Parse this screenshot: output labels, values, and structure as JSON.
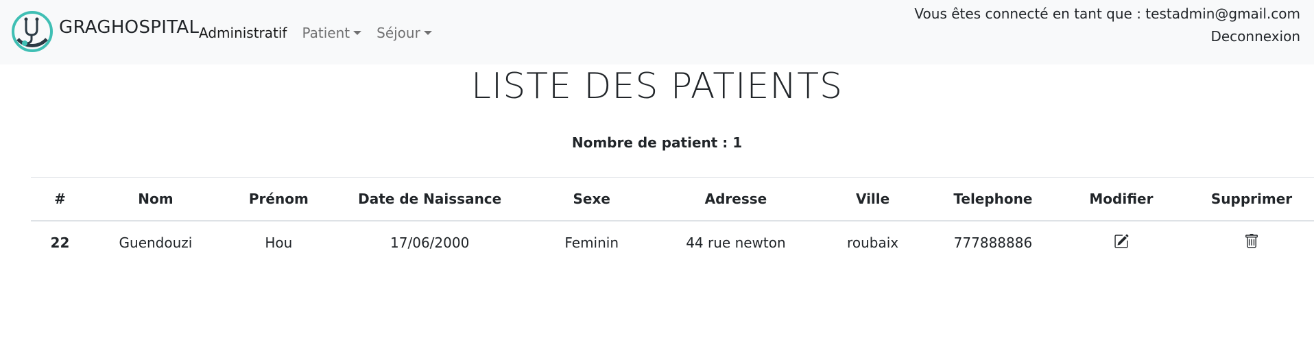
{
  "brand": {
    "name": "GRAGHOSPITAL"
  },
  "nav": {
    "items": [
      {
        "label": "Administratif"
      },
      {
        "label": "Patient"
      },
      {
        "label": "Séjour"
      }
    ]
  },
  "user": {
    "connected_text": "Vous êtes connecté en tant que : testadmin@gmail.com",
    "logout_label": "Deconnexion"
  },
  "page": {
    "title": "LISTE DES PATIENTS",
    "count_text": "Nombre de patient : 1"
  },
  "table": {
    "headers": [
      "#",
      "Nom",
      "Prénom",
      "Date de Naissance",
      "Sexe",
      "Adresse",
      "Ville",
      "Telephone",
      "Modifier",
      "Supprimer"
    ],
    "rows": [
      {
        "id": "22",
        "nom": "Guendouzi",
        "prenom": "Hou",
        "date_naissance": "17/06/2000",
        "sexe": "Feminin",
        "adresse": "44 rue newton",
        "ville": "roubaix",
        "telephone": "777888886",
        "modifier_icon": "edit-icon",
        "supprimer_icon": "trash-icon"
      }
    ]
  },
  "colors": {
    "navbar_bg": "#f8f9fa",
    "logo_teal": "#3fbfb4",
    "logo_dark": "#2b3a44"
  }
}
